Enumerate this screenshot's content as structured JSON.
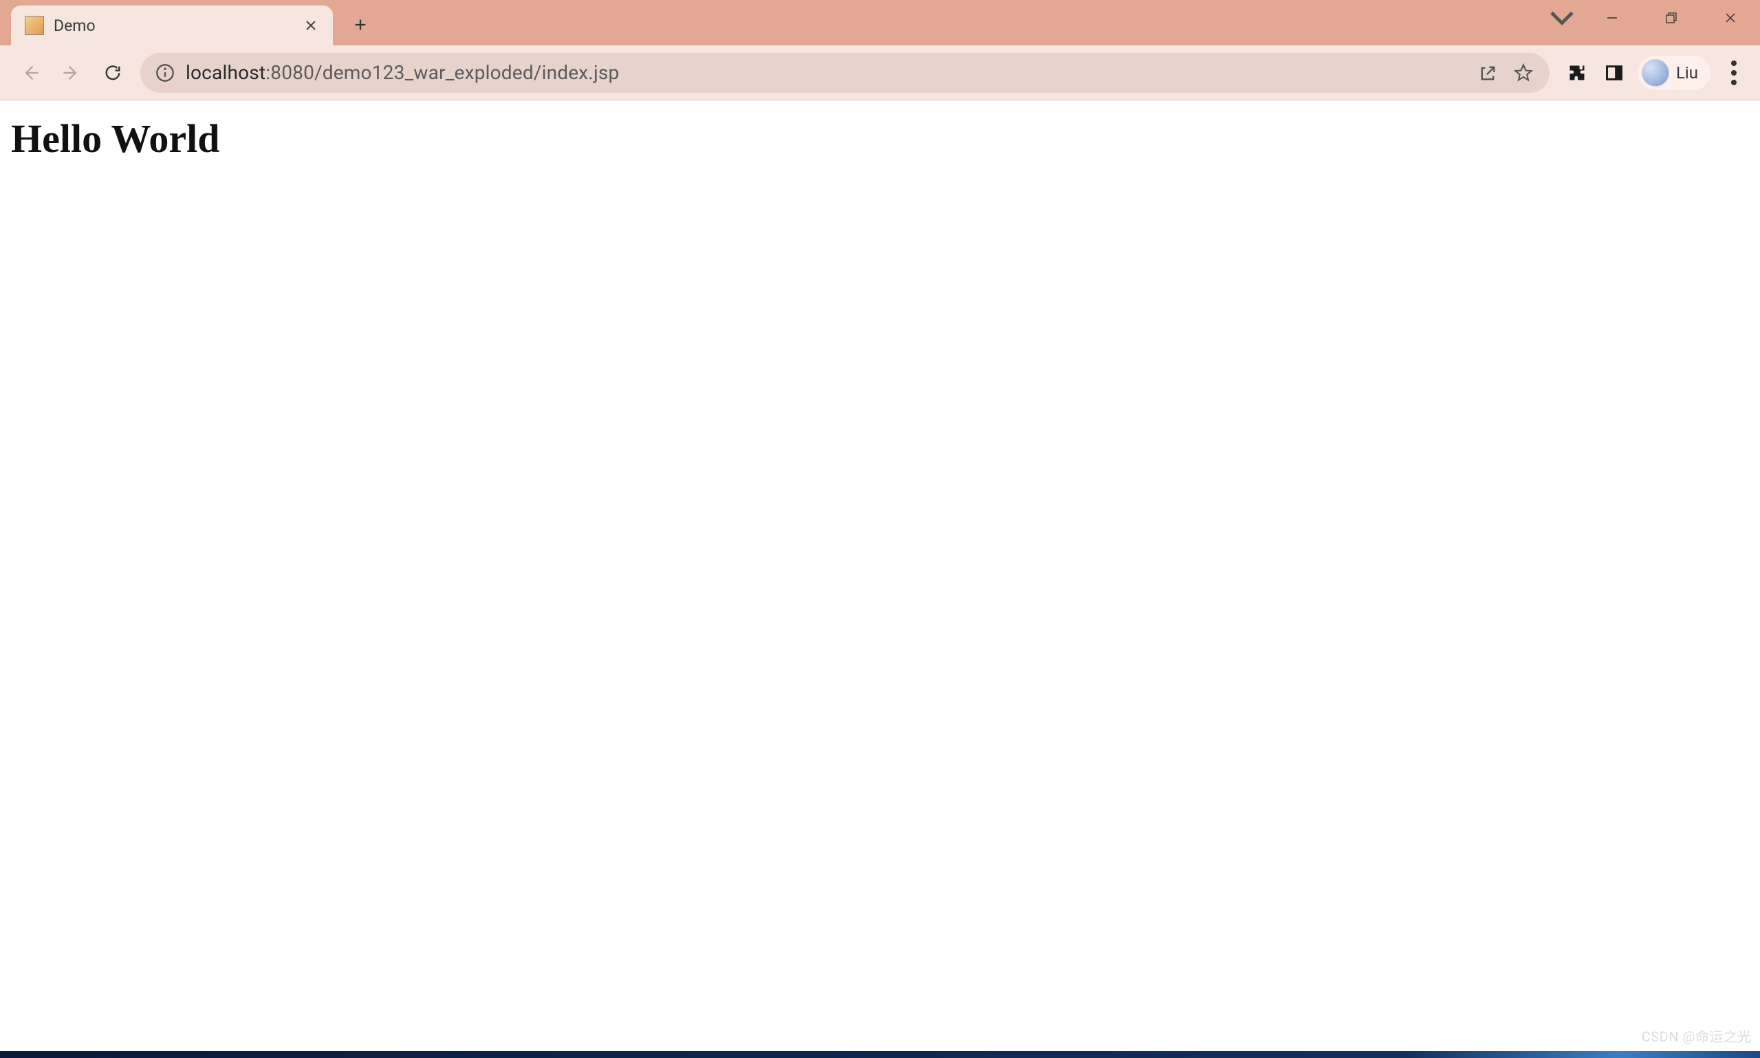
{
  "tab": {
    "title": "Demo"
  },
  "url": {
    "host": "localhost",
    "rest": ":8080/demo123_war_exploded/index.jsp"
  },
  "profile": {
    "name": "Liu"
  },
  "page": {
    "heading": "Hello World"
  },
  "watermark": "CSDN @命运之光"
}
